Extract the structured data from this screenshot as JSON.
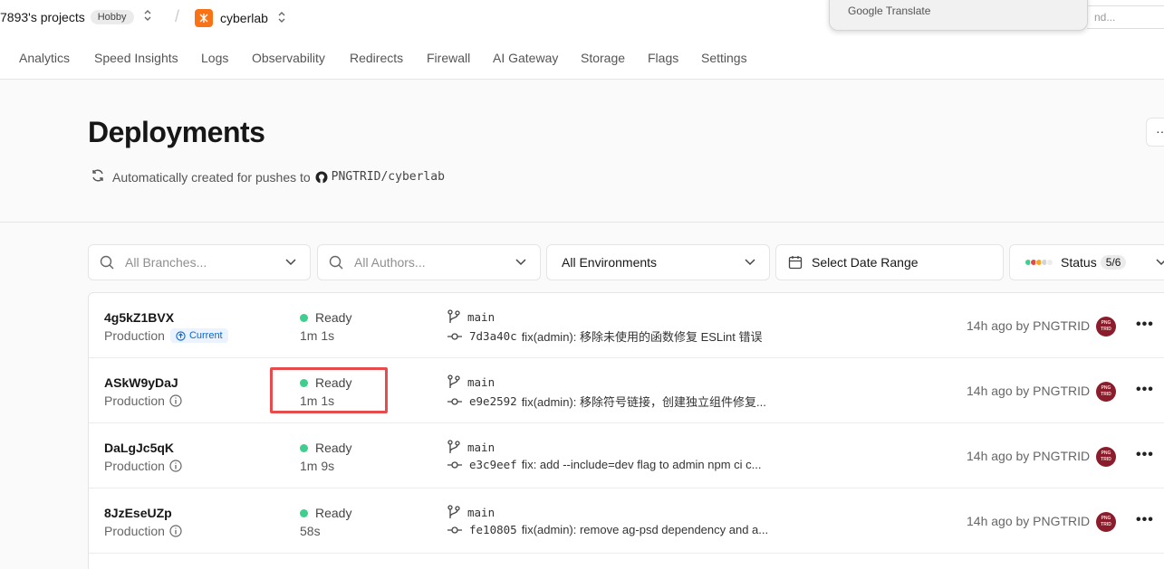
{
  "topbar": {
    "team": "7893's projects",
    "plan_badge": "Hobby",
    "project": "cyberlab",
    "translate_label": "Google Translate",
    "find_placeholder": "Find..."
  },
  "tabs": [
    "Analytics",
    "Speed Insights",
    "Logs",
    "Observability",
    "Redirects",
    "Firewall",
    "AI Gateway",
    "Storage",
    "Flags",
    "Settings"
  ],
  "header": {
    "title": "Deployments",
    "subtitle": "Automatically created for pushes to",
    "repo": "PNGTRID/cyberlab"
  },
  "filters": {
    "branches_placeholder": "All Branches...",
    "authors_placeholder": "All Authors...",
    "environments": "All Environments",
    "date_range": "Select Date Range",
    "status_label": "Status",
    "status_count": "5/6",
    "status_colors": [
      "#3ecf8e",
      "#e5484d",
      "#f5a623",
      "#d4d4d4",
      "#e5e5e5"
    ]
  },
  "deployments": [
    {
      "id": "4g5kZ1BVX",
      "env": "Production",
      "current_label": "Current",
      "status": "Ready",
      "duration": "1m 1s",
      "branch": "main",
      "hash": "7d3a40c",
      "message": "fix(admin): 移除未使用的函数修复 ESLint 错误",
      "ago": "14h ago by PNGTRID"
    },
    {
      "id": "ASkW9yDaJ",
      "env": "Production",
      "status": "Ready",
      "duration": "1m 1s",
      "branch": "main",
      "hash": "e9e2592",
      "message": "fix(admin): 移除符号链接，创建独立组件修复...",
      "ago": "14h ago by PNGTRID"
    },
    {
      "id": "DaLgJc5qK",
      "env": "Production",
      "status": "Ready",
      "duration": "1m 9s",
      "branch": "main",
      "hash": "e3c9eef",
      "message": "fix: add --include=dev flag to admin npm ci c...",
      "ago": "14h ago by PNGTRID"
    },
    {
      "id": "8JzEseUZp",
      "env": "Production",
      "status": "Ready",
      "duration": "58s",
      "branch": "main",
      "hash": "fe10805",
      "message": "fix(admin): remove ag-psd dependency and a...",
      "ago": "14h ago by PNGTRID"
    }
  ],
  "avatar_text": "PNG TRID",
  "colors": {
    "ready": "#3ecf8e",
    "highlight": "#e74c4c",
    "current_bg": "#eaf3ff",
    "current_fg": "#0068d6",
    "avatar": "#8b1c2c"
  }
}
